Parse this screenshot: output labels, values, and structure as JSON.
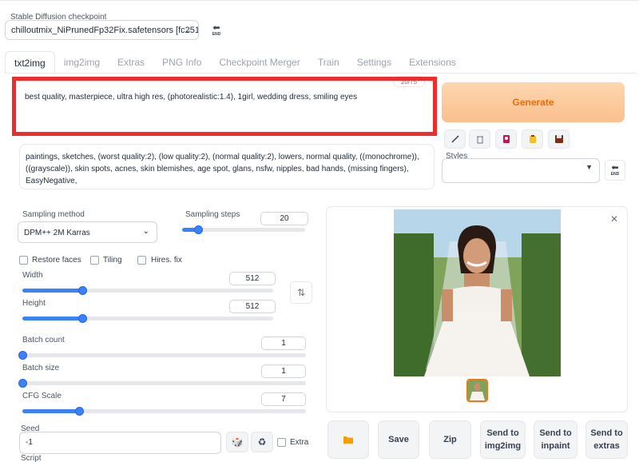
{
  "checkpoint": {
    "label": "Stable Diffusion checkpoint",
    "value": "chilloutmix_NiPrunedFp32Fix.safetensors [fc251"
  },
  "end_button_text": "END",
  "tabs": [
    "txt2img",
    "img2img",
    "Extras",
    "PNG Info",
    "Checkpoint Merger",
    "Train",
    "Settings",
    "Extensions"
  ],
  "active_tab": "txt2img",
  "prompt": {
    "value": "best quality, masterpiece, ultra high res, (photorealistic:1.4), 1girl, wedding dress, smiling eyes",
    "token_count": "20/75"
  },
  "negative_prompt": {
    "value": "paintings, sketches, (worst quality:2), (low quality:2), (normal quality:2), lowers, normal quality, ((monochrome)), ((grayscale)), skin spots, acnes, skin blemishes, age spot, glans, nsfw, nipples, bad hands, (missing fingers), EasyNegative,"
  },
  "generate_label": "Generate",
  "styles_label": "Styles",
  "sampling": {
    "method_label": "Sampling method",
    "method_value": "DPM++ 2M Karras",
    "steps_label": "Sampling steps",
    "steps_value": "20"
  },
  "checkboxes": {
    "restore_faces": "Restore faces",
    "tiling": "Tiling",
    "hires_fix": "Hires. fix",
    "extra": "Extra"
  },
  "width": {
    "label": "Width",
    "value": "512"
  },
  "height": {
    "label": "Height",
    "value": "512"
  },
  "batch_count": {
    "label": "Batch count",
    "value": "1"
  },
  "batch_size": {
    "label": "Batch size",
    "value": "1"
  },
  "cfg_scale": {
    "label": "CFG Scale",
    "value": "7"
  },
  "seed": {
    "label": "Seed",
    "value": "-1"
  },
  "script_label": "Script",
  "actions": {
    "save": "Save",
    "zip": "Zip",
    "send_img2img_1": "Send to",
    "send_img2img_2": "img2img",
    "send_inpaint_1": "Send to",
    "send_inpaint_2": "inpaint",
    "send_extras_1": "Send to",
    "send_extras_2": "extras"
  },
  "sliders": {
    "sampling_steps": 0.13,
    "width": 0.24,
    "height": 0.24,
    "batch_count": 0.0,
    "batch_size": 0.0,
    "cfg_scale": 0.2
  },
  "colors": {
    "accent": "#3b82f6",
    "generate_text": "#ea6d0e",
    "highlight": "#ef2b2b"
  }
}
